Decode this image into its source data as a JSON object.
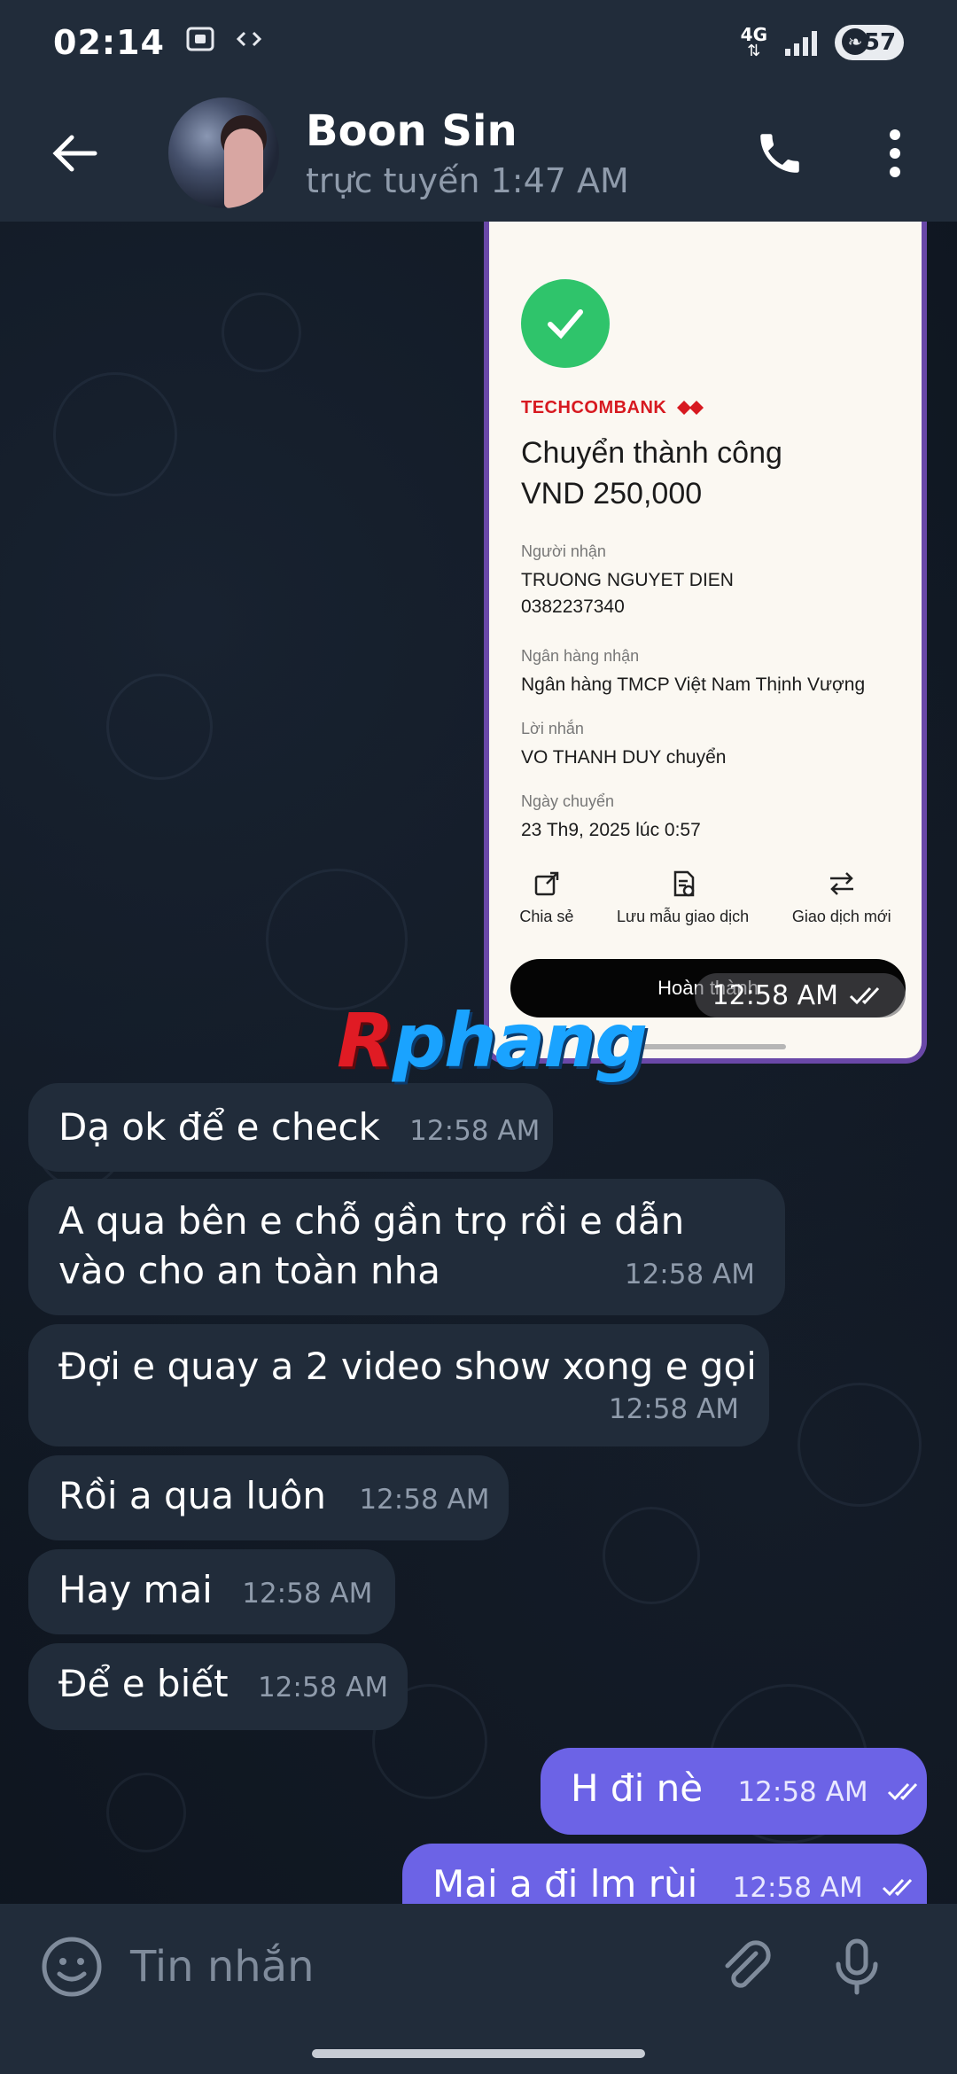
{
  "status_bar": {
    "time": "02:14",
    "network": "4G",
    "battery": "57",
    "icons": [
      "screenshot-icon",
      "code-icon",
      "data-arrows-icon",
      "signal-icon",
      "battery-icon"
    ]
  },
  "header": {
    "contact_name": "Boon Sin",
    "contact_status": "trực tuyến 1:47 AM",
    "icons": [
      "back-arrow-icon",
      "phone-icon",
      "more-vertical-icon"
    ]
  },
  "photo_message": {
    "bank": "TECHCOMBANK",
    "title_line1": "Chuyển thành công",
    "title_line2": "VND 250,000",
    "recipient_label": "Người nhận",
    "recipient_name": "TRUONG NGUYET DIEN",
    "recipient_account": "0382237340",
    "bank_label": "Ngân hàng nhận",
    "bank_value": "Ngân hàng TMCP Việt Nam Thịnh Vượng",
    "message_label": "Lời nhắn",
    "message_value": "VO THANH DUY chuyển",
    "date_label": "Ngày chuyển",
    "date_value": "23 Th9, 2025 lúc 0:57",
    "actions": [
      {
        "label": "Chia sẻ",
        "icon": "share-icon"
      },
      {
        "label": "Lưu mẫu giao dịch",
        "icon": "save-template-icon"
      },
      {
        "label": "Giao dịch mới",
        "icon": "swap-icon"
      }
    ],
    "done_label": "Hoàn thành",
    "time": "12:58 AM",
    "colors": {
      "success": "#2fc46b",
      "brand": "#d71920"
    }
  },
  "watermark": {
    "first": "R",
    "rest": "phang"
  },
  "messages": [
    {
      "direction": "in",
      "text": "Dạ ok để e check",
      "time": "12:58 AM"
    },
    {
      "direction": "in",
      "text": "A qua bên e chỗ gần trọ rồi e dẫn vào cho an toàn nha",
      "time": "12:58 AM"
    },
    {
      "direction": "in",
      "text": "Đợi e quay a 2 video show xong e gọi",
      "time": "12:58 AM"
    },
    {
      "direction": "in",
      "text": "Rồi a qua luôn",
      "time": "12:58 AM"
    },
    {
      "direction": "in",
      "text": "Hay mai",
      "time": "12:58 AM"
    },
    {
      "direction": "in",
      "text": "Để e biết",
      "time": "12:58 AM"
    },
    {
      "direction": "out",
      "text": "H đi nè",
      "time": "12:58 AM"
    },
    {
      "direction": "out",
      "text": "Mai a đi lm rùi",
      "time": "12:58 AM"
    }
  ],
  "input": {
    "placeholder": "Tin nhắn"
  },
  "colors": {
    "outgoing_bubble": "#6c63e6",
    "incoming_bubble": "#212c3a",
    "header": "#212c3a"
  }
}
